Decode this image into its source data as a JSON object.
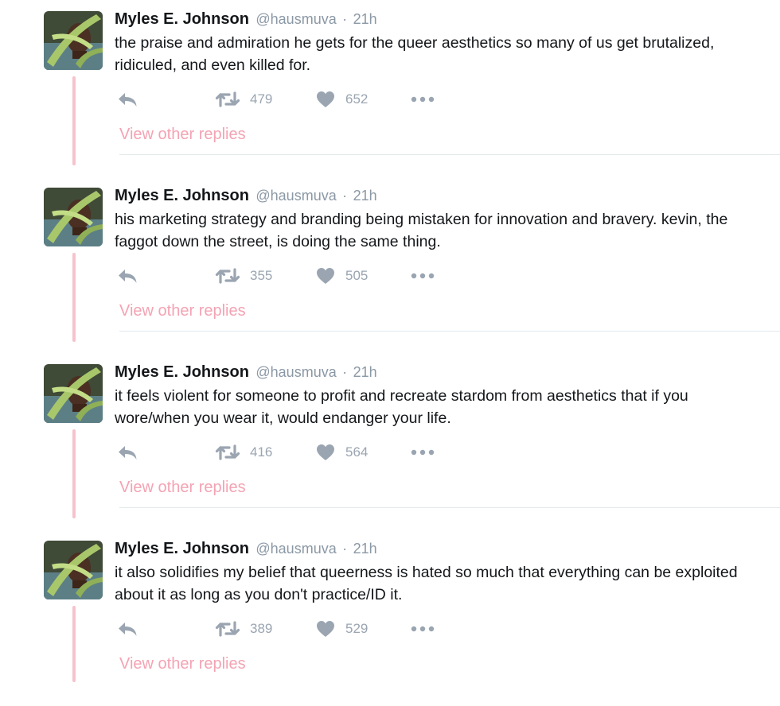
{
  "colors": {
    "thread_line": "#f6c3cc",
    "view_replies": "#f4a3b3",
    "action_gray": "#9aa5b1",
    "meta_gray": "#8b98a5"
  },
  "icons": {
    "reply": "reply-arrow-icon",
    "retweet": "retweet-icon",
    "like": "heart-icon",
    "more": "ellipsis-icon"
  },
  "tweets": [
    {
      "name": "Myles E. Johnson",
      "handle": "@hausmuva",
      "separator": "·",
      "time": "21h",
      "text": "the praise and admiration he gets for the queer aesthetics so many of us get brutalized, ridiculed, and even killed for.",
      "retweets": "479",
      "likes": "652",
      "view_replies": "View other replies"
    },
    {
      "name": "Myles E. Johnson",
      "handle": "@hausmuva",
      "separator": "·",
      "time": "21h",
      "text": "his marketing strategy and branding being mistaken for innovation and bravery. kevin, the faggot down the street, is doing the same thing.",
      "retweets": "355",
      "likes": "505",
      "view_replies": "View other replies"
    },
    {
      "name": "Myles E. Johnson",
      "handle": "@hausmuva",
      "separator": "·",
      "time": "21h",
      "text": "it feels violent for someone to profit and recreate stardom from aesthetics that if you wore/when you wear it, would endanger your life.",
      "retweets": "416",
      "likes": "564",
      "view_replies": "View other replies"
    },
    {
      "name": "Myles E. Johnson",
      "handle": "@hausmuva",
      "separator": "·",
      "time": "21h",
      "text": "it also solidifies my belief that queerness is hated so much that everything can be exploited about it as long as you don't practice/ID it.",
      "retweets": "389",
      "likes": "529",
      "view_replies": "View other replies"
    }
  ]
}
